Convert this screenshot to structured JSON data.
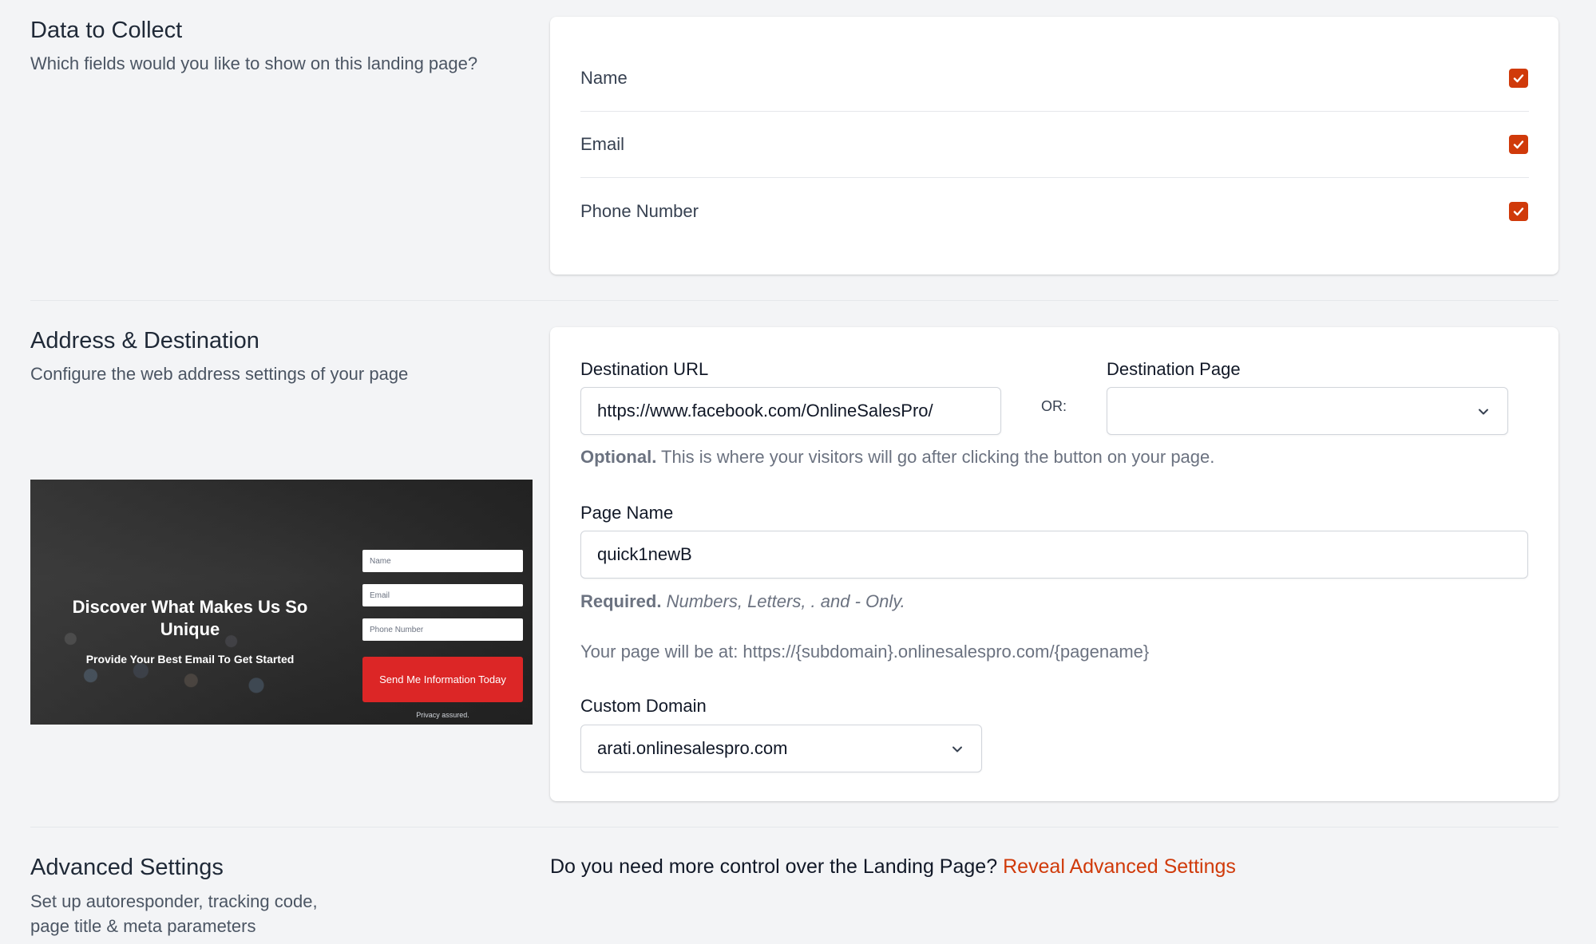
{
  "data_collect": {
    "title": "Data to Collect",
    "description": "Which fields would you like to show on this landing page?",
    "fields": [
      {
        "label": "Name",
        "checked": true
      },
      {
        "label": "Email",
        "checked": true
      },
      {
        "label": "Phone Number",
        "checked": true
      }
    ]
  },
  "address": {
    "title": "Address & Destination",
    "description": "Configure the web address settings of your page",
    "destination_url_label": "Destination URL",
    "destination_url_value": "https://www.facebook.com/OnlineSalesPro/",
    "or_label": "OR:",
    "destination_page_label": "Destination Page",
    "destination_page_value": "",
    "destination_hint_bold": "Optional.",
    "destination_hint_text": "This is where your visitors will go after clicking the button on your page.",
    "page_name_label": "Page Name",
    "page_name_value": "quick1newB",
    "page_name_hint_bold": "Required.",
    "page_name_hint_italic": "Numbers, Letters, . and - Only.",
    "page_url_hint": "Your page will be at: https://{subdomain}.onlinesalespro.com/{pagename}",
    "custom_domain_label": "Custom Domain",
    "custom_domain_value": "arati.onlinesalespro.com"
  },
  "preview": {
    "headline": "Discover What Makes Us So Unique",
    "subheadline": "Provide Your Best Email To Get Started",
    "name_placeholder": "Name",
    "email_placeholder": "Email",
    "phone_placeholder": "Phone Number",
    "button_label": "Send Me Information Today",
    "privacy": "Privacy assured."
  },
  "advanced": {
    "title": "Advanced Settings",
    "description_line1": "Set up autoresponder, tracking code,",
    "description_line2": "page title & meta parameters",
    "prompt": "Do you need more control over the Landing Page?",
    "reveal_link": "Reveal Advanced Settings"
  },
  "colors": {
    "accent": "#d03a0a",
    "background": "#f3f4f6",
    "card": "#ffffff"
  }
}
